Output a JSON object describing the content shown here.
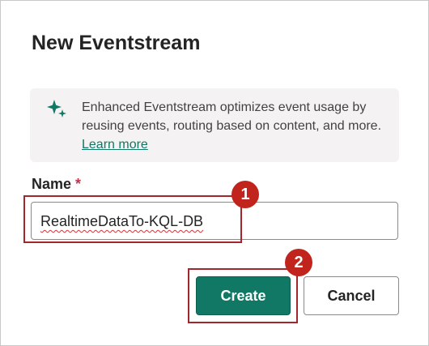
{
  "dialog": {
    "title": "New Eventstream",
    "info": {
      "text": "Enhanced Eventstream optimizes event usage by reusing events, routing based on content, and more.",
      "link_label": "Learn more",
      "icon": "sparkle-icon"
    },
    "name_field": {
      "label": "Name",
      "required_mark": "*",
      "value": "RealtimeDataTo-KQL-DB"
    },
    "buttons": {
      "create_label": "Create",
      "cancel_label": "Cancel"
    }
  },
  "annotations": {
    "step1": "1",
    "step2": "2"
  },
  "colors": {
    "accent": "#117865",
    "callout": "#c0241c",
    "highlight_border": "#a4262c",
    "info_background": "#f5f2f3"
  }
}
